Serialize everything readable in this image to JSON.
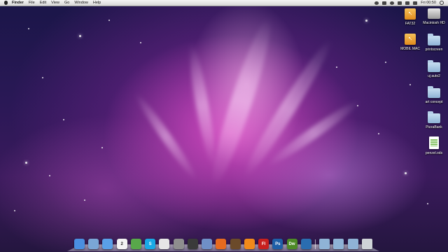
{
  "menubar": {
    "app": "Finder",
    "menus": [
      "File",
      "Edit",
      "View",
      "Go",
      "Window",
      "Help"
    ],
    "clock": "Fri 00:50"
  },
  "desktop_icons": [
    {
      "label": "FAT32",
      "type": "usb-drive"
    },
    {
      "label": "Macintosh HD",
      "type": "hard-drive"
    },
    {
      "label": "MOBIL MAC",
      "type": "usb-drive"
    },
    {
      "label": "printscreen",
      "type": "folder"
    },
    {
      "label": "uj auto2",
      "type": "folder"
    },
    {
      "label": "art concept",
      "type": "folder"
    },
    {
      "label": "PizzaBank",
      "type": "folder"
    },
    {
      "label": "penzel.ods",
      "type": "spreadsheet-document"
    }
  ],
  "dock": {
    "apps": [
      {
        "name": "finder-icon",
        "color": "#4a8fe0",
        "glyph": ""
      },
      {
        "name": "mail-icon",
        "color": "#7aa6d6",
        "glyph": ""
      },
      {
        "name": "safari-icon",
        "color": "#5aa0e8",
        "glyph": ""
      },
      {
        "name": "ical-icon",
        "color": "#f2f2f2",
        "glyph": "2"
      },
      {
        "name": "adium-icon",
        "color": "#58a84a",
        "glyph": ""
      },
      {
        "name": "skype-icon",
        "color": "#19a9e5",
        "glyph": "S"
      },
      {
        "name": "textedit-icon",
        "color": "#e6e6e6",
        "glyph": ""
      },
      {
        "name": "system-preferences-icon",
        "color": "#8e8e8e",
        "glyph": ""
      },
      {
        "name": "activity-monitor-icon",
        "color": "#3a3a3a",
        "glyph": ""
      },
      {
        "name": "itunes-icon",
        "color": "#6f8fc7",
        "glyph": ""
      },
      {
        "name": "firefox-icon",
        "color": "#e66a1f",
        "glyph": ""
      },
      {
        "name": "app-icon",
        "color": "#6b4a2a",
        "glyph": ""
      },
      {
        "name": "vlc-icon",
        "color": "#f08a1a",
        "glyph": ""
      },
      {
        "name": "flash-icon",
        "color": "#c8201e",
        "glyph": "Fl"
      },
      {
        "name": "photoshop-icon",
        "color": "#1f5fa8",
        "glyph": "Ps"
      },
      {
        "name": "dreamweaver-icon",
        "color": "#4d8a26",
        "glyph": "Dw"
      },
      {
        "name": "quicktime-icon",
        "color": "#2a6db0",
        "glyph": ""
      }
    ],
    "stacks": [
      {
        "name": "applications-stack-icon",
        "color": "#8fb3d6"
      },
      {
        "name": "documents-stack-icon",
        "color": "#8fb3d6"
      },
      {
        "name": "downloads-stack-icon",
        "color": "#8fb3d6"
      },
      {
        "name": "trash-icon",
        "color": "#cfd3d8"
      }
    ]
  }
}
